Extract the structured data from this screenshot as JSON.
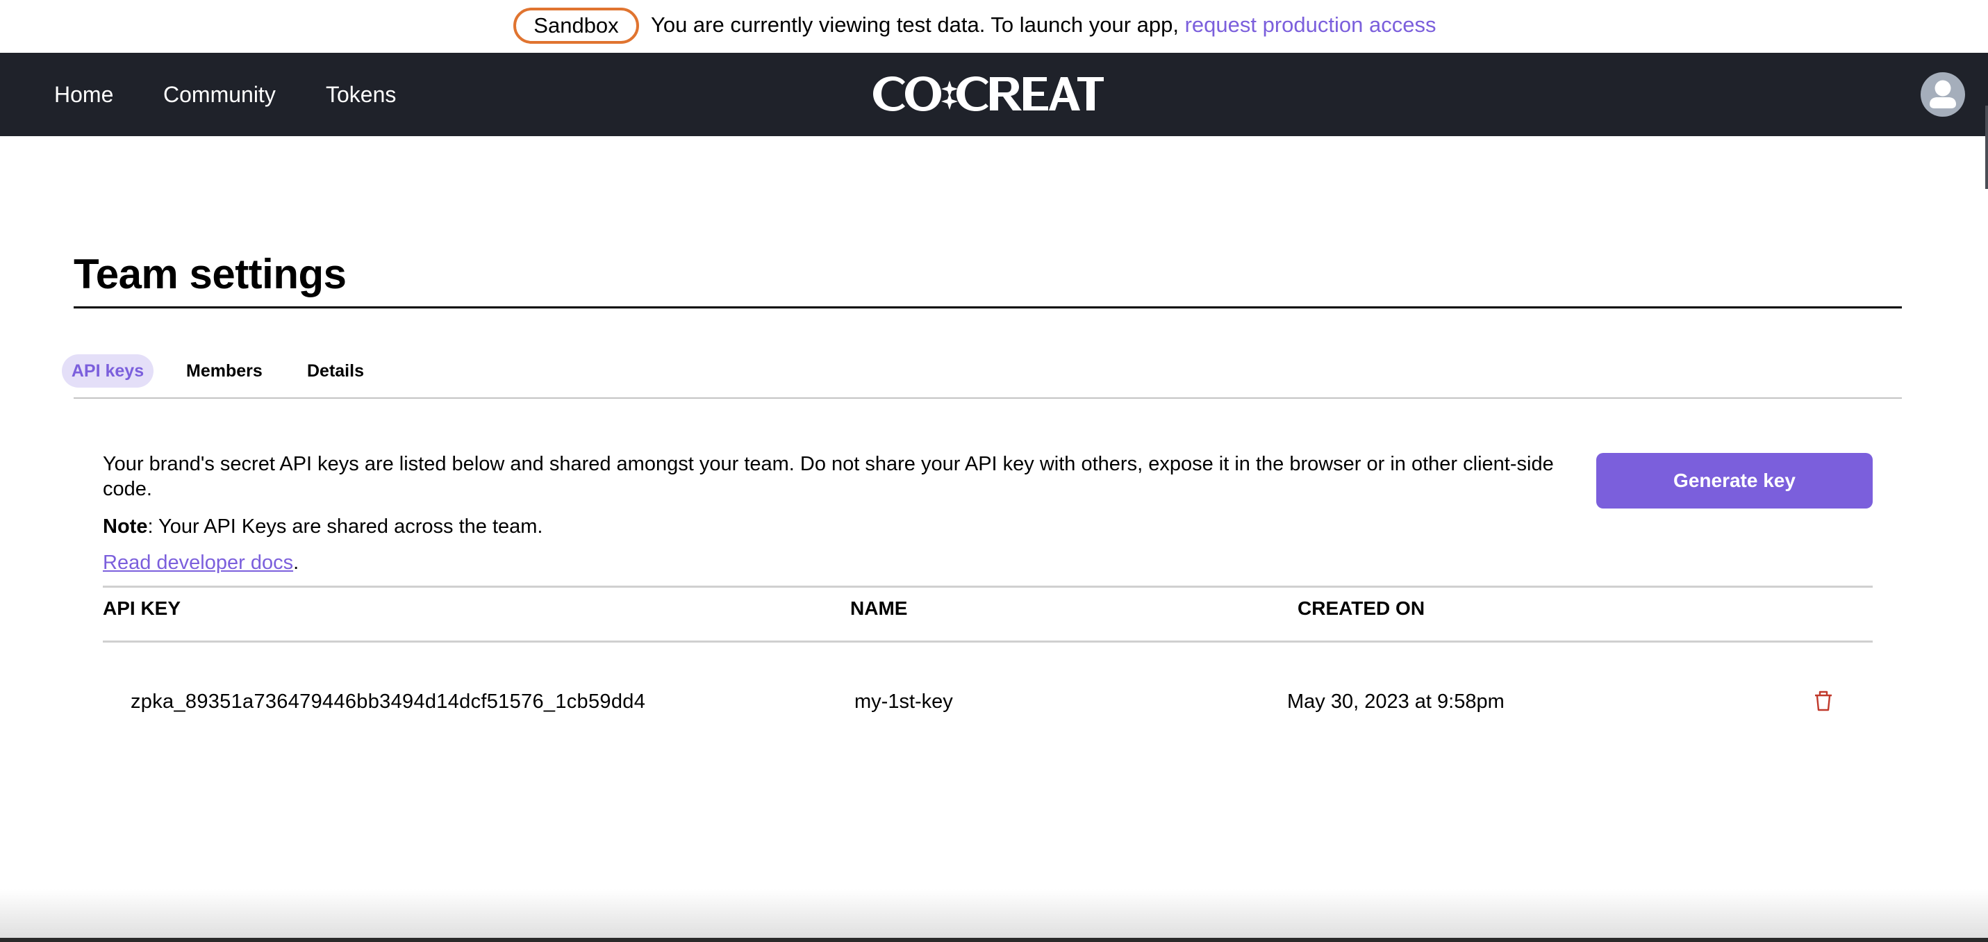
{
  "banner": {
    "badge": "Sandbox",
    "message": "You are currently viewing test data. To launch your app, ",
    "link_label": "request production access"
  },
  "nav": {
    "items": [
      {
        "label": "Home"
      },
      {
        "label": "Community"
      },
      {
        "label": "Tokens"
      }
    ],
    "logo_text": "CO:CREATE",
    "avatar_icon": "user-avatar-icon"
  },
  "page": {
    "title": "Team settings",
    "tabs": [
      {
        "label": "API keys",
        "active": true
      },
      {
        "label": "Members",
        "active": false
      },
      {
        "label": "Details",
        "active": false
      }
    ]
  },
  "api_keys": {
    "description": "Your brand's secret API keys are listed below and shared amongst your team. Do not share your API key with others, expose it in the browser or in other client-side code.",
    "note_label": "Note",
    "note_text": ": Your API Keys are shared across the team.",
    "docs_link": "Read developer docs",
    "docs_suffix": ".",
    "generate_button": "Generate key",
    "table": {
      "columns": [
        "API KEY",
        "NAME",
        "CREATED ON"
      ],
      "rows": [
        {
          "api_key": "zpka_89351a736479446bb3494d14dcf51576_1cb59dd4",
          "name": "my-1st-key",
          "created_on": "May 30, 2023 at 9:58pm",
          "action_icon": "trash-icon"
        }
      ]
    }
  },
  "colors": {
    "accent": "#7b5fdc",
    "accent_light": "#e4dff8",
    "nav_bg": "#1f222a",
    "sandbox_border": "#e07430",
    "danger": "#c0392b"
  }
}
